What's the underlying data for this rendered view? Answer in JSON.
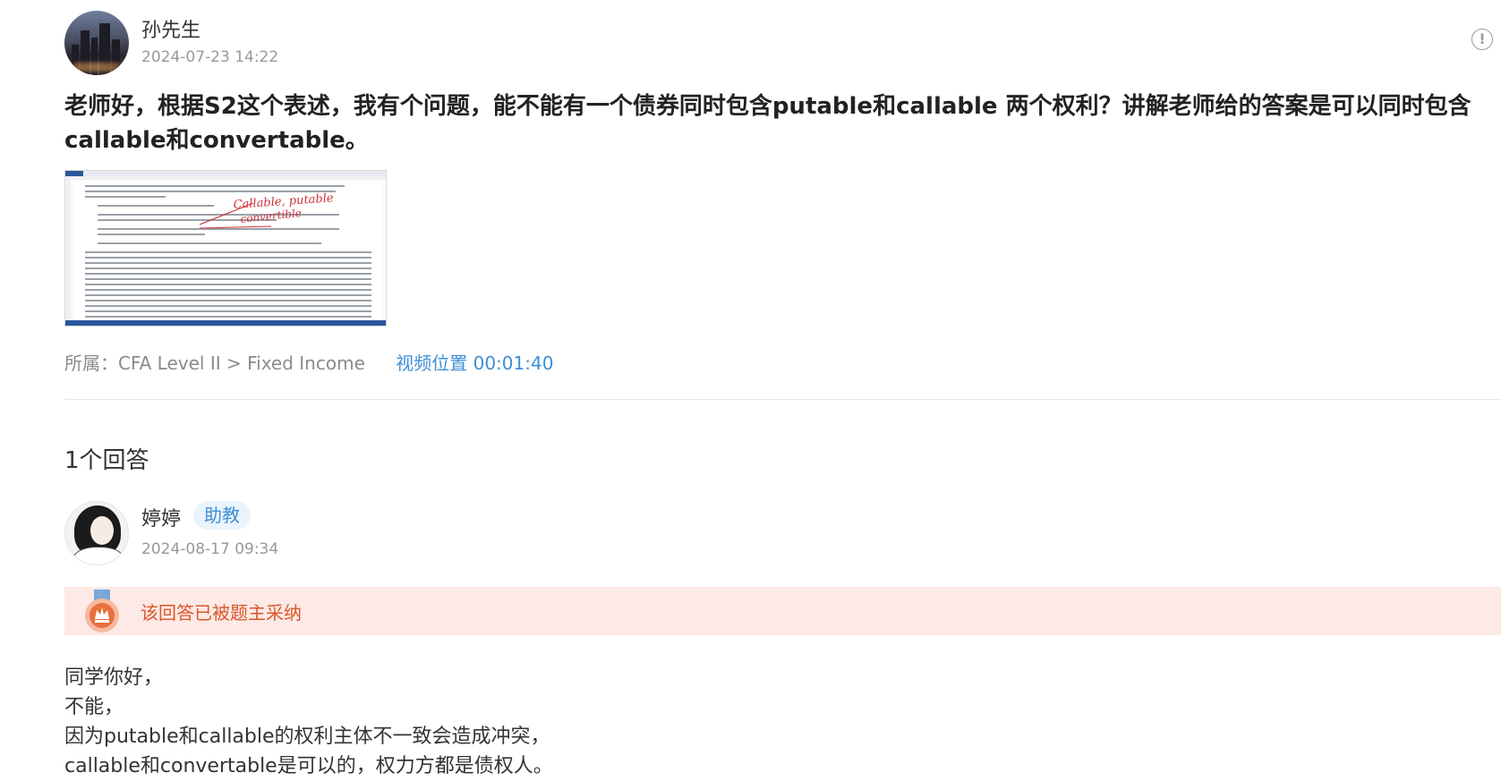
{
  "question": {
    "author_name": "孙先生",
    "timestamp": "2024-07-23 14:22",
    "text": "老师好，根据S2这个表述，我有个问题，能不能有一个债券同时包含putable和callable 两个权利？讲解老师给的答案是可以同时包含callable和convertable。",
    "attachment_handwriting": {
      "line1": "Callable, putable",
      "line2": "convertible"
    },
    "category_label": "所属：",
    "category_path": "CFA Level II > Fixed Income",
    "video_position": "视频位置 00:01:40"
  },
  "answers": {
    "count_label": "1个回答",
    "items": [
      {
        "author_name": "婷婷",
        "role_badge": "助教",
        "timestamp": "2024-08-17 09:34",
        "accepted_text": "该回答已被题主采纳",
        "body_lines": [
          "同学你好，",
          "不能，",
          "因为putable和callable的权利主体不一致会造成冲突，",
          "callable和convertable是可以的，权力方都是债权人。"
        ]
      }
    ]
  },
  "icons": {
    "report": "alert-circle-icon",
    "medal": "medal-icon"
  },
  "colors": {
    "link": "#3d8fd6",
    "badge_bg": "#eaf4fc",
    "accepted_bg": "#fde9e5",
    "accepted_text": "#d9572a"
  }
}
